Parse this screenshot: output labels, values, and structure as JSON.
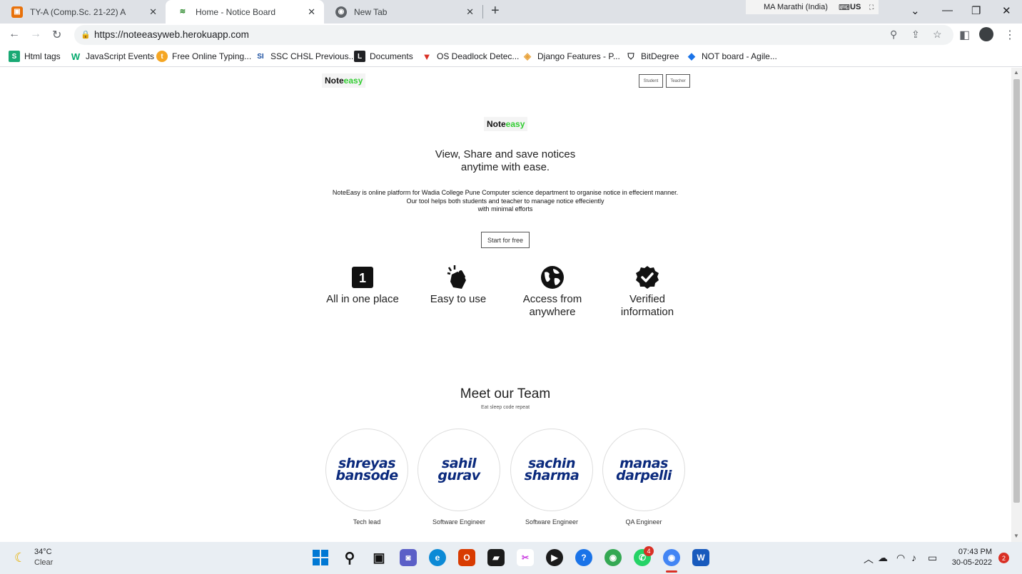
{
  "browser": {
    "tabs": [
      {
        "title": "TY-A (Comp.Sc. 21-22) A",
        "active": false
      },
      {
        "title": "Home - Notice Board",
        "active": true
      },
      {
        "title": "New Tab",
        "active": false
      }
    ],
    "ime_language": "MA Marathi (India)",
    "keyboard": "US",
    "url": "https://noteeasyweb.herokuapp.com",
    "bookmarks": [
      {
        "label": "Html tags",
        "icon": "s-icon",
        "color": "#19a974"
      },
      {
        "label": "JavaScript Events",
        "icon": "w3-icon",
        "color": "#04aa6d"
      },
      {
        "label": "Free Online Typing...",
        "icon": "typing-icon",
        "color": "#f5a623"
      },
      {
        "label": "SSC CHSL Previous...",
        "icon": "ssc-icon",
        "color": "#1a4fa0"
      },
      {
        "label": "Documents",
        "icon": "documents-icon",
        "color": "#202124"
      },
      {
        "label": "OS Deadlock Detec...",
        "icon": "os-icon",
        "color": "#d93025"
      },
      {
        "label": "Django Features - P...",
        "icon": "django-icon",
        "color": "#e8a33d"
      },
      {
        "label": "BitDegree",
        "icon": "bitdegree-icon",
        "color": "#202124"
      },
      {
        "label": "NOT board - Agile...",
        "icon": "diamond-icon",
        "color": "#1a73e8"
      }
    ]
  },
  "site": {
    "logo_prefix": "Note",
    "logo_accent": "easy",
    "accent_color": "#32cd32",
    "nav": {
      "student": "Student",
      "teacher": "Teacher"
    },
    "hero": {
      "headline_line1": "View, Share and save notices",
      "headline_line2": "anytime with ease.",
      "desc_line1": "NoteEasy is online platform for Wadia College Pune Computer science department to organise notice in effecient manner.",
      "desc_line2": "Our tool helps both students and teacher to manage notice effeciently",
      "desc_line3": "with minimal efforts",
      "cta": "Start for free"
    },
    "features": [
      {
        "line1": "All in one place",
        "line2": "",
        "icon": "number-one-icon"
      },
      {
        "line1": "Easy to use",
        "line2": "",
        "icon": "snap-hand-icon"
      },
      {
        "line1": "Access from",
        "line2": "anywhere",
        "icon": "globe-icon"
      },
      {
        "line1": "Verified",
        "line2": "information",
        "icon": "verified-badge-icon"
      }
    ],
    "team": {
      "title": "Meet our Team",
      "subtitle": "Eat sleep code repeat",
      "members": [
        {
          "first": "shreyas",
          "last": "bansode",
          "role": "Tech lead"
        },
        {
          "first": "sahil",
          "last": "gurav",
          "role": "Software Engineer"
        },
        {
          "first": "sachin",
          "last": "sharma",
          "role": "Software Engineer"
        },
        {
          "first": "manas",
          "last": "darpelli",
          "role": "QA Engineer"
        }
      ]
    }
  },
  "taskbar": {
    "weather_temp": "34°C",
    "weather_desc": "Clear",
    "time": "07:43 PM",
    "date": "30-05-2022",
    "notification_count": "2",
    "whatsapp_badge": "4"
  }
}
